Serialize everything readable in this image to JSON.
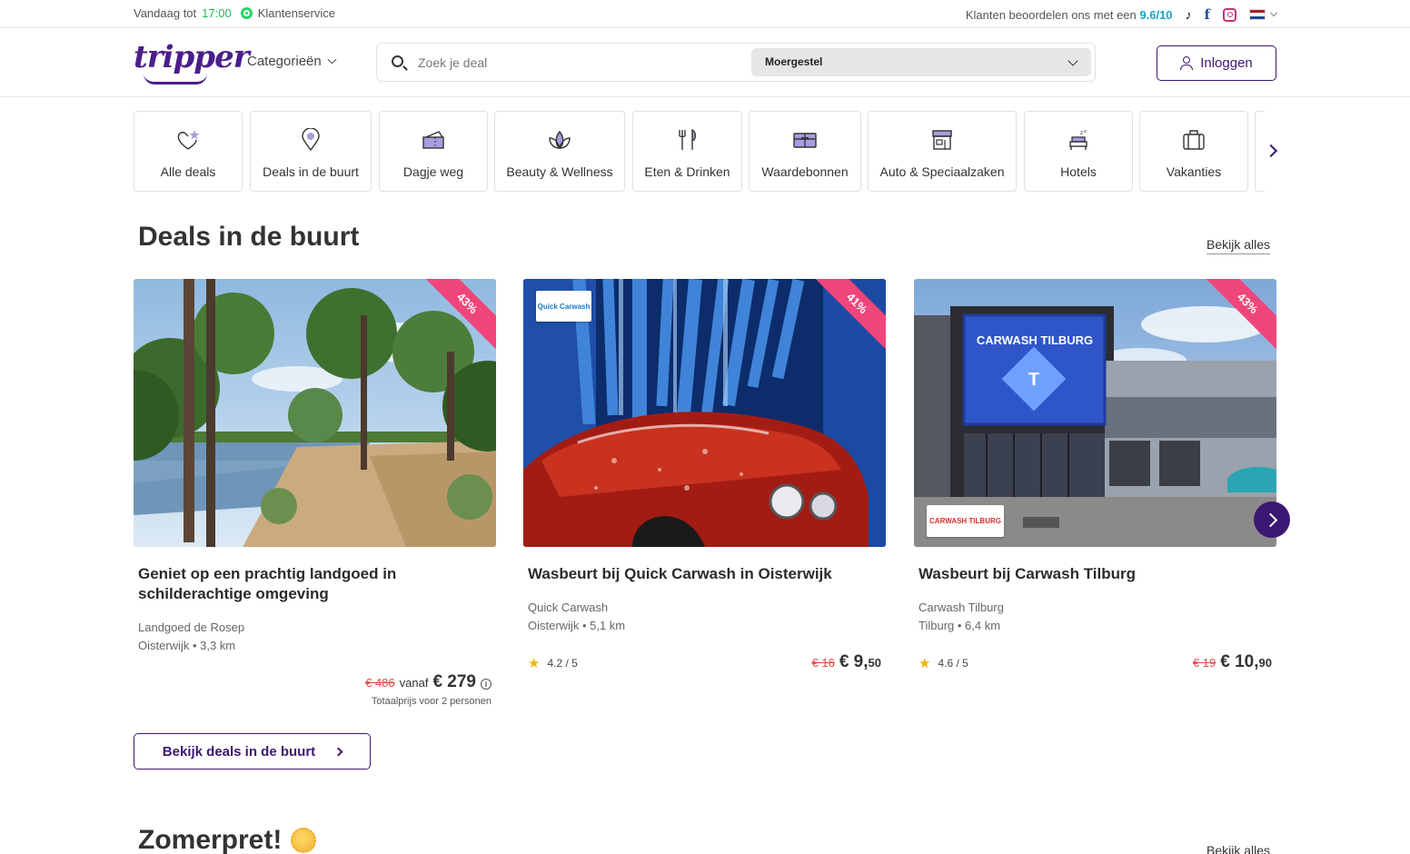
{
  "topbar": {
    "hours_prefix": "Vandaag tot",
    "hours_time": "17:00",
    "customer_service": "Klantenservice",
    "rating_text": "Klanten beoordelen ons met een",
    "rating_score": "9.6/10",
    "tiktok_glyph": "♪",
    "facebook_glyph": "f"
  },
  "header": {
    "logo": "tripper",
    "categories_label": "Categorieën",
    "search_placeholder": "Zoek je deal",
    "location_value": "Moergestel",
    "login_label": "Inloggen"
  },
  "categories": [
    {
      "label": "Alle deals",
      "icon": "heart-star-icon"
    },
    {
      "label": "Deals in de buurt",
      "icon": "location-pin-icon"
    },
    {
      "label": "Dagje weg",
      "icon": "ticket-icon"
    },
    {
      "label": "Beauty & Wellness",
      "icon": "lotus-icon"
    },
    {
      "label": "Eten & Drinken",
      "icon": "fork-knife-icon"
    },
    {
      "label": "Waardebonnen",
      "icon": "gift-card-icon"
    },
    {
      "label": "Auto & Speciaalzaken",
      "icon": "shop-icon"
    },
    {
      "label": "Hotels",
      "icon": "bed-icon"
    },
    {
      "label": "Vakanties",
      "icon": "suitcase-icon"
    }
  ],
  "section1": {
    "title": "Deals in de buurt",
    "see_all": "Bekijk alles",
    "button": "Bekijk deals in de buurt"
  },
  "deals": [
    {
      "discount": "43%",
      "title": "Geniet op een prachtig landgoed in schilderachtige omgeving",
      "merchant": "Landgoed de Rosep",
      "location": "Oisterwijk • 3,3 km",
      "old_price": "€ 486",
      "from_label": "vanaf",
      "price": "€ 279",
      "total_note": "Totaalprijs voor 2 personen"
    },
    {
      "discount": "41%",
      "title": "Wasbeurt bij Quick Carwash in Oisterwijk",
      "merchant": "Quick Carwash",
      "location": "Oisterwijk • 5,1 km",
      "rating": "4.2 / 5",
      "old_price": "€ 16",
      "price_main": "€ 9,",
      "price_cents": "50",
      "badge": "Quick Carwash"
    },
    {
      "discount": "43%",
      "title": "Wasbeurt bij Carwash Tilburg",
      "merchant": "Carwash Tilburg",
      "location": "Tilburg • 6,4 km",
      "rating": "4.6 / 5",
      "old_price": "€ 19",
      "price_main": "€ 10,",
      "price_cents": "90",
      "sign": "CARWASH TILBURG",
      "badge": "CARWASH TILBURG"
    }
  ],
  "section2": {
    "title": "Zomerpret!",
    "see_all": "Bekijk alles"
  },
  "colors": {
    "brand": "#3b1873",
    "ribbon": "#f0457a",
    "whatsapp": "#25d366",
    "score": "#15a7c7"
  }
}
